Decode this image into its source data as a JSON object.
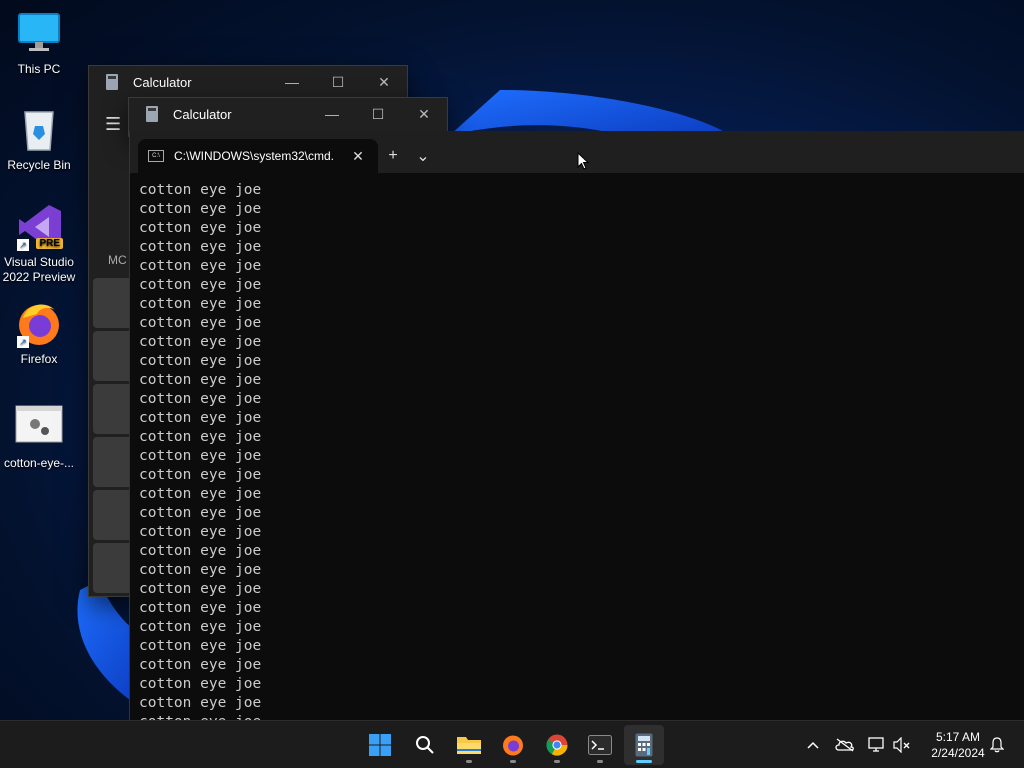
{
  "desktop": {
    "icons": [
      {
        "label": "This PC"
      },
      {
        "label": "Recycle Bin"
      },
      {
        "label": "Visual Studio 2022 Preview",
        "badge": "PRE"
      },
      {
        "label": "Firefox"
      },
      {
        "label": "cotton-eye-..."
      }
    ]
  },
  "calc_back": {
    "title": "Calculator",
    "partial_label": "MC"
  },
  "calc_front": {
    "title": "Calculator"
  },
  "terminal": {
    "tab_title": "C:\\WINDOWS\\system32\\cmd.",
    "tab_icon_text": "C:\\",
    "close_glyph": "✕",
    "newtab_glyph": "+",
    "dropdown_glyph": "⌄",
    "output_line": "cotton eye joe",
    "line_count": 29
  },
  "taskbar": {
    "apps": [
      {
        "name": "start"
      },
      {
        "name": "search"
      },
      {
        "name": "file-explorer"
      },
      {
        "name": "firefox"
      },
      {
        "name": "chrome"
      },
      {
        "name": "terminal"
      },
      {
        "name": "calculator",
        "active": true
      }
    ],
    "time": "5:17 AM",
    "date": "2/24/2024"
  },
  "colors": {
    "accent": "#60cdff",
    "terminal_bg": "#0c0c0c",
    "window_bg": "#202020"
  }
}
